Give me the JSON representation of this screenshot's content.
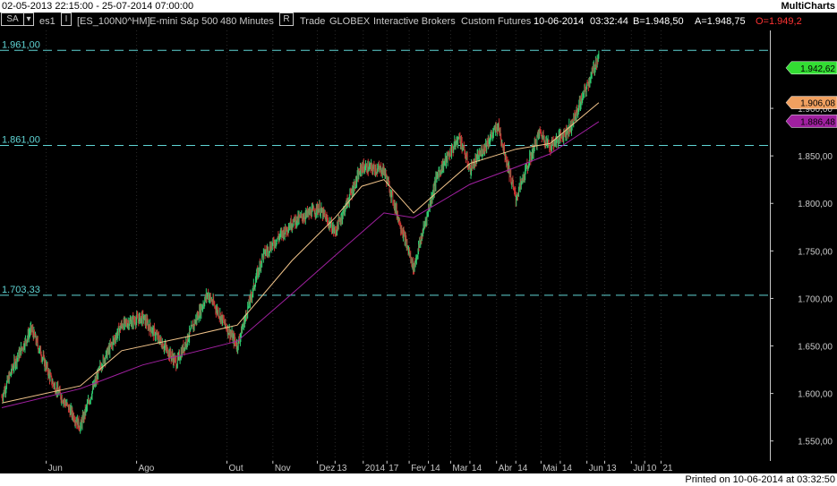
{
  "window": {
    "date_range": "02-05-2013 22:15:00 - 25-07-2014 07:00:00",
    "brand": "MultiCharts",
    "printed": "Printed on 10-06-2014 at 03:32:50"
  },
  "toolbar": {
    "symbol_box": "SA",
    "dropdown_glyph": "▾",
    "chart_name": "es1",
    "toggle_glyph": "I",
    "instrument": "[ES_100N0^HM]",
    "description": "E-mini S&p 500",
    "interval": "480 Minutes",
    "r_box": "R",
    "data_type": "Trade",
    "exchange": "GLOBEX",
    "broker": "Interactive Brokers",
    "category": "Custom Futures",
    "date": "10-06-2014",
    "time": "03:32:44",
    "bid": "B=1.948,50",
    "ask": "A=1.948,75",
    "open": "O=1.949,2"
  },
  "colors": {
    "background": "#000000",
    "up_candle": "#2ecc71",
    "down_candle": "#cc3333",
    "ma_fast": "#f2c48a",
    "ma_slow": "#a020a0",
    "hline": "#5fd4d4",
    "axis_text": "#c8c8c8"
  },
  "chart_data": {
    "type": "line",
    "title": "",
    "x_ticks": [
      "Jun",
      "Ago",
      "Out",
      "Nov",
      "Dez",
      "13",
      "2014",
      "17",
      "Fev",
      "14",
      "Mar",
      "14",
      "Abr",
      "14",
      "Mai",
      "14",
      "Jun",
      "13",
      "Jul",
      "10",
      "21"
    ],
    "y_ticks": [
      "1.550,00",
      "1.600,00",
      "1.650,00",
      "1.700,00",
      "1.750,00",
      "1.800,00",
      "1.850,00",
      "1.900,00"
    ],
    "ylim": [
      1529,
      1982
    ],
    "horizontal_lines": [
      {
        "label": "1.961,00",
        "value": 1961.0
      },
      {
        "label": "1.861,00",
        "value": 1861.0
      },
      {
        "label": "1.703,33",
        "value": 1703.33
      }
    ],
    "price_markers": [
      {
        "label": "1.942,62",
        "value": 1942.62,
        "color": "#33dd33"
      },
      {
        "label": "1.906,08",
        "value": 1906.08,
        "color": "#f0a060"
      },
      {
        "label": "1.886,48",
        "value": 1886.48,
        "color": "#a020a0"
      }
    ],
    "series": [
      {
        "points": [
          [
            "2013-05-02",
            1596
          ],
          [
            "2013-05-10",
            1630
          ],
          [
            "2013-05-22",
            1668
          ],
          [
            "2013-06-05",
            1612
          ],
          [
            "2013-06-24",
            1565
          ],
          [
            "2013-07-08",
            1630
          ],
          [
            "2013-07-22",
            1672
          ],
          [
            "2013-08-05",
            1680
          ],
          [
            "2013-08-28",
            1632
          ],
          [
            "2013-09-18",
            1705
          ],
          [
            "2013-10-08",
            1650
          ],
          [
            "2013-10-25",
            1745
          ],
          [
            "2013-11-14",
            1780
          ],
          [
            "2013-12-02",
            1795
          ],
          [
            "2013-12-13",
            1770
          ],
          [
            "2013-12-31",
            1838
          ],
          [
            "2014-01-15",
            1835
          ],
          [
            "2014-02-04",
            1732
          ],
          [
            "2014-02-20",
            1830
          ],
          [
            "2014-03-07",
            1870
          ],
          [
            "2014-03-14",
            1835
          ],
          [
            "2014-04-02",
            1882
          ],
          [
            "2014-04-14",
            1805
          ],
          [
            "2014-04-30",
            1875
          ],
          [
            "2014-05-07",
            1860
          ],
          [
            "2014-05-21",
            1880
          ],
          [
            "2014-06-09",
            1955
          ]
        ]
      },
      {
        "points": [
          [
            "2013-05-02",
            1590
          ],
          [
            "2013-06-24",
            1608
          ],
          [
            "2013-07-22",
            1645
          ],
          [
            "2013-09-05",
            1660
          ],
          [
            "2013-10-08",
            1672
          ],
          [
            "2013-11-14",
            1740
          ],
          [
            "2013-12-13",
            1785
          ],
          [
            "2013-12-31",
            1818
          ],
          [
            "2014-01-15",
            1825
          ],
          [
            "2014-02-04",
            1790
          ],
          [
            "2014-02-20",
            1812
          ],
          [
            "2014-03-14",
            1842
          ],
          [
            "2014-04-14",
            1857
          ],
          [
            "2014-05-07",
            1863
          ],
          [
            "2014-06-09",
            1906
          ]
        ]
      },
      {
        "points": [
          [
            "2013-05-02",
            1585
          ],
          [
            "2013-06-24",
            1605
          ],
          [
            "2013-08-05",
            1630
          ],
          [
            "2013-10-08",
            1655
          ],
          [
            "2013-11-14",
            1705
          ],
          [
            "2013-12-13",
            1745
          ],
          [
            "2014-01-15",
            1790
          ],
          [
            "2014-02-04",
            1785
          ],
          [
            "2014-03-14",
            1820
          ],
          [
            "2014-04-14",
            1838
          ],
          [
            "2014-05-07",
            1852
          ],
          [
            "2014-06-09",
            1886
          ]
        ]
      }
    ]
  }
}
